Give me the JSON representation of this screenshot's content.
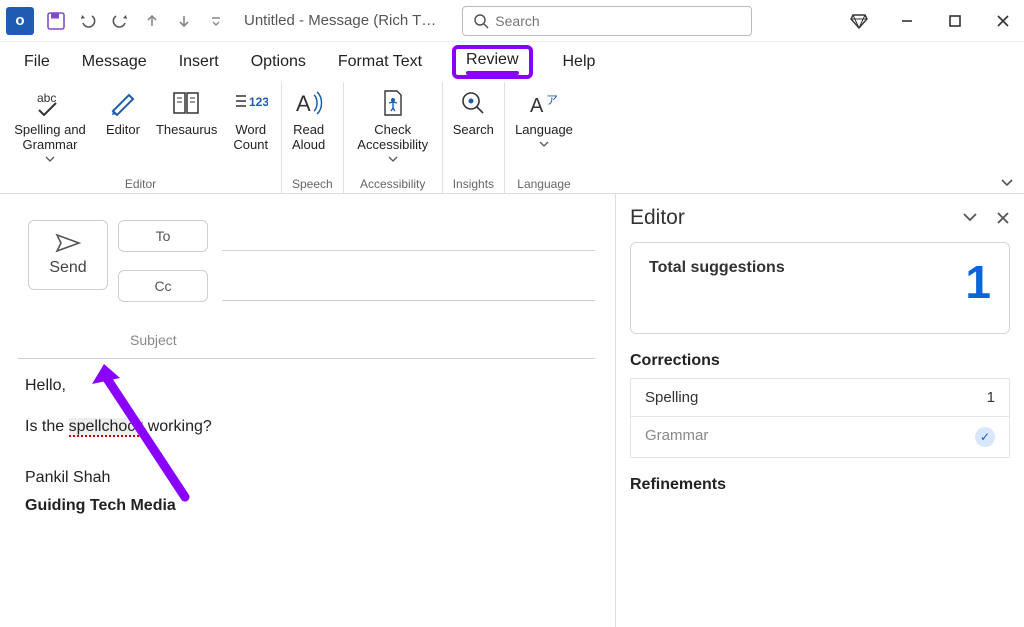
{
  "titlebar": {
    "app_abbrev": "o",
    "title": "Untitled - Message (Rich T…",
    "search_placeholder": "Search"
  },
  "tabs": {
    "file": "File",
    "message": "Message",
    "insert": "Insert",
    "options": "Options",
    "format_text": "Format Text",
    "review": "Review",
    "help": "Help"
  },
  "ribbon": {
    "spelling_grammar": "Spelling and\nGrammar",
    "editor": "Editor",
    "thesaurus": "Thesaurus",
    "word_count": "Word\nCount",
    "read_aloud": "Read\nAloud",
    "check_accessibility": "Check\nAccessibility",
    "search": "Search",
    "language": "Language",
    "groups": {
      "editor": "Editor",
      "speech": "Speech",
      "accessibility": "Accessibility",
      "insights": "Insights",
      "language": "Language"
    }
  },
  "compose": {
    "send": "Send",
    "to": "To",
    "cc": "Cc",
    "subject": "Subject",
    "line1": "Hello,",
    "line2a": "Is the ",
    "line2b": "spellchock",
    "line2c": " working?",
    "sig1": "Pankil Shah",
    "sig2": "Guiding Tech Media"
  },
  "editor_pane": {
    "title": "Editor",
    "total_label": "Total suggestions",
    "total_value": "1",
    "corrections": "Corrections",
    "spelling_label": "Spelling",
    "spelling_count": "1",
    "grammar_label": "Grammar",
    "refinements": "Refinements"
  }
}
